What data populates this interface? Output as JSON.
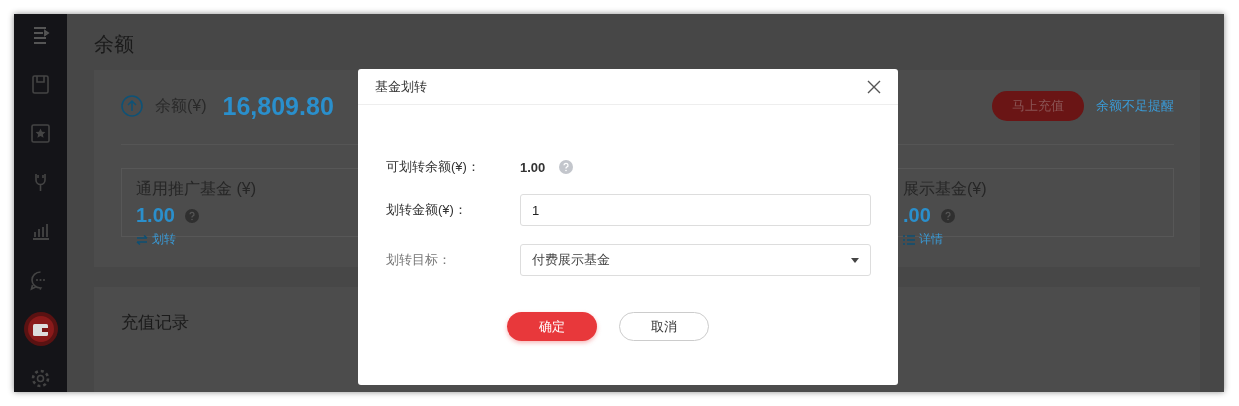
{
  "sidebar": {
    "items": [
      {
        "selected": false
      },
      {
        "selected": false
      },
      {
        "selected": false
      },
      {
        "selected": false
      },
      {
        "selected": false
      },
      {
        "selected": false
      },
      {
        "selected": true
      },
      {
        "selected": false
      }
    ]
  },
  "page": {
    "title": "余额",
    "balance_label": "余额(¥)",
    "balance_value": "16,809.80",
    "recharge_button": "马上充值",
    "low_balance_link": "余额不足提醒",
    "funds": [
      {
        "title": "通用推广基金 (¥)",
        "value": "1.00",
        "links": [
          "划转"
        ]
      },
      {
        "title": "展示基金(¥)",
        "value": ".00",
        "links": [
          "详情"
        ]
      }
    ],
    "records_title": "充值记录"
  },
  "dialog": {
    "title": "基金划转",
    "available_label": "可划转余额(¥)：",
    "available_value": "1.00",
    "amount_label": "划转金额(¥)：",
    "amount_value": "1",
    "target_label": "划转目标：",
    "target_value": "付费展示基金",
    "confirm_button": "确定",
    "cancel_button": "取消"
  }
}
